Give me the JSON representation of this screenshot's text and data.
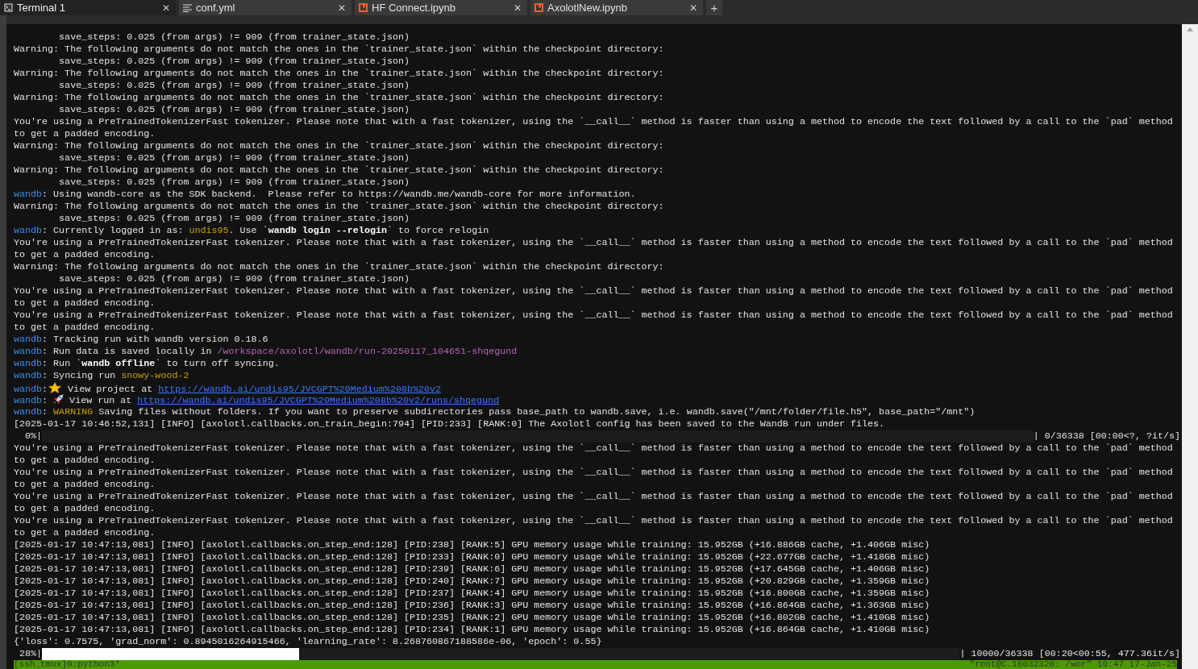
{
  "tabs": [
    {
      "label": "Terminal 1",
      "kind": "terminal",
      "selected": true
    },
    {
      "label": "conf.yml",
      "kind": "text",
      "selected": false
    },
    {
      "label": "HF Connect.ipynb",
      "kind": "notebook",
      "selected": false
    },
    {
      "label": "AxolotlNew.ipynb",
      "kind": "notebook",
      "selected": false
    }
  ],
  "new_tab": "+",
  "close_glyph": "✕",
  "lines": [
    "        save_steps: 0.025 (from args) != 909 (from trainer_state.json)",
    "Warning: The following arguments do not match the ones in the `trainer_state.json` within the checkpoint directory:",
    "        save_steps: 0.025 (from args) != 909 (from trainer_state.json)",
    "Warning: The following arguments do not match the ones in the `trainer_state.json` within the checkpoint directory:",
    "        save_steps: 0.025 (from args) != 909 (from trainer_state.json)",
    "Warning: The following arguments do not match the ones in the `trainer_state.json` within the checkpoint directory:",
    "        save_steps: 0.025 (from args) != 909 (from trainer_state.json)",
    "You're using a PreTrainedTokenizerFast tokenizer. Please note that with a fast tokenizer, using the `__call__` method is faster than using a method to encode the text followed by a call to the `pad` method",
    "to get a padded encoding.",
    "Warning: The following arguments do not match the ones in the `trainer_state.json` within the checkpoint directory:",
    "        save_steps: 0.025 (from args) != 909 (from trainer_state.json)",
    "Warning: The following arguments do not match the ones in the `trainer_state.json` within the checkpoint directory:",
    "        save_steps: 0.025 (from args) != 909 (from trainer_state.json)",
    {
      "segments": [
        {
          "kind": "prefix",
          "t": "wandb"
        },
        {
          "kind": "plain",
          "t": ": Using wandb-core as the SDK backend.  Please refer to https://wandb.me/wandb-core for more information."
        }
      ]
    },
    "Warning: The following arguments do not match the ones in the `trainer_state.json` within the checkpoint directory:",
    "        save_steps: 0.025 (from args) != 909 (from trainer_state.json)",
    {
      "segments": [
        {
          "kind": "prefix",
          "t": "wandb"
        },
        {
          "kind": "plain",
          "t": ": Currently logged in as: "
        },
        {
          "kind": "yellow",
          "t": "undis95"
        },
        {
          "kind": "plain",
          "t": ". Use `"
        },
        {
          "kind": "bold",
          "t": "wandb login --relogin"
        },
        {
          "kind": "plain",
          "t": "` to force relogin"
        }
      ]
    },
    "You're using a PreTrainedTokenizerFast tokenizer. Please note that with a fast tokenizer, using the `__call__` method is faster than using a method to encode the text followed by a call to the `pad` method",
    "to get a padded encoding.",
    "Warning: The following arguments do not match the ones in the `trainer_state.json` within the checkpoint directory:",
    "        save_steps: 0.025 (from args) != 909 (from trainer_state.json)",
    "You're using a PreTrainedTokenizerFast tokenizer. Please note that with a fast tokenizer, using the `__call__` method is faster than using a method to encode the text followed by a call to the `pad` method",
    "to get a padded encoding.",
    "You're using a PreTrainedTokenizerFast tokenizer. Please note that with a fast tokenizer, using the `__call__` method is faster than using a method to encode the text followed by a call to the `pad` method",
    "to get a padded encoding.",
    {
      "segments": [
        {
          "kind": "prefix",
          "t": "wandb"
        },
        {
          "kind": "plain",
          "t": ": Tracking run with wandb version 0.18.6"
        }
      ]
    },
    {
      "segments": [
        {
          "kind": "prefix",
          "t": "wandb"
        },
        {
          "kind": "plain",
          "t": ": Run data is saved locally in "
        },
        {
          "kind": "path",
          "t": "/workspace/axolotl/wandb/run-20250117_104651-shqegund"
        }
      ]
    },
    {
      "segments": [
        {
          "kind": "prefix",
          "t": "wandb"
        },
        {
          "kind": "plain",
          "t": ": Run `"
        },
        {
          "kind": "bold",
          "t": "wandb offline"
        },
        {
          "kind": "plain",
          "t": "` to turn off syncing."
        }
      ]
    },
    {
      "segments": [
        {
          "kind": "prefix",
          "t": "wandb"
        },
        {
          "kind": "plain",
          "t": ": Syncing run "
        },
        {
          "kind": "yellow",
          "t": "snowy-wood-2"
        }
      ]
    },
    {
      "segments": [
        {
          "kind": "prefix",
          "t": "wandb"
        },
        {
          "kind": "plain",
          "t": ":"
        },
        {
          "kind": "star"
        },
        {
          "kind": "plain",
          "t": " View project at "
        },
        {
          "kind": "link",
          "t": "https://wandb.ai/undis95/JVCGPT%20Medium%208b%20v2"
        }
      ]
    },
    {
      "segments": [
        {
          "kind": "prefix",
          "t": "wandb"
        },
        {
          "kind": "plain",
          "t": ": "
        },
        {
          "kind": "rocket"
        },
        {
          "kind": "plain",
          "t": " View run at "
        },
        {
          "kind": "link",
          "t": "https://wandb.ai/undis95/JVCGPT%20Medium%208b%20v2/runs/shqegund"
        }
      ]
    },
    {
      "segments": [
        {
          "kind": "prefix",
          "t": "wandb"
        },
        {
          "kind": "plain",
          "t": ": "
        },
        {
          "kind": "yellow",
          "t": "WARNING"
        },
        {
          "kind": "plain",
          "t": " Saving files without folders. If you want to preserve subdirectories pass base_path to wandb.save, i.e. wandb.save(\"/mnt/folder/file.h5\", base_path=\"/mnt\")"
        }
      ]
    },
    "[2025-01-17 10:46:52,131] [INFO] [axolotl.callbacks.on_train_begin:794] [PID:233] [RANK:0] The Axolotl config has been saved to the WandB run under files.",
    {
      "kind": "progress",
      "left": "  0%|",
      "level": 0,
      "right": "| 0/36338 [00:00<?, ?it/s]"
    },
    "You're using a PreTrainedTokenizerFast tokenizer. Please note that with a fast tokenizer, using the `__call__` method is faster than using a method to encode the text followed by a call to the `pad` method",
    "to get a padded encoding.",
    "You're using a PreTrainedTokenizerFast tokenizer. Please note that with a fast tokenizer, using the `__call__` method is faster than using a method to encode the text followed by a call to the `pad` method",
    "to get a padded encoding.",
    "You're using a PreTrainedTokenizerFast tokenizer. Please note that with a fast tokenizer, using the `__call__` method is faster than using a method to encode the text followed by a call to the `pad` method",
    "to get a padded encoding.",
    "You're using a PreTrainedTokenizerFast tokenizer. Please note that with a fast tokenizer, using the `__call__` method is faster than using a method to encode the text followed by a call to the `pad` method",
    "to get a padded encoding.",
    "[2025-01-17 10:47:13,081] [INFO] [axolotl.callbacks.on_step_end:128] [PID:238] [RANK:5] GPU memory usage while training: 15.952GB (+16.886GB cache, +1.406GB misc)",
    "[2025-01-17 10:47:13,081] [INFO] [axolotl.callbacks.on_step_end:128] [PID:233] [RANK:0] GPU memory usage while training: 15.952GB (+22.677GB cache, +1.418GB misc)",
    "[2025-01-17 10:47:13,081] [INFO] [axolotl.callbacks.on_step_end:128] [PID:239] [RANK:6] GPU memory usage while training: 15.952GB (+17.645GB cache, +1.406GB misc)",
    "[2025-01-17 10:47:13,081] [INFO] [axolotl.callbacks.on_step_end:128] [PID:240] [RANK:7] GPU memory usage while training: 15.952GB (+20.829GB cache, +1.359GB misc)",
    "[2025-01-17 10:47:13,081] [INFO] [axolotl.callbacks.on_step_end:128] [PID:237] [RANK:4] GPU memory usage while training: 15.952GB (+16.800GB cache, +1.359GB misc)",
    "[2025-01-17 10:47:13,081] [INFO] [axolotl.callbacks.on_step_end:128] [PID:236] [RANK:3] GPU memory usage while training: 15.952GB (+16.864GB cache, +1.363GB misc)",
    "[2025-01-17 10:47:13,081] [INFO] [axolotl.callbacks.on_step_end:128] [PID:235] [RANK:2] GPU memory usage while training: 15.952GB (+16.802GB cache, +1.410GB misc)",
    "[2025-01-17 10:47:13,081] [INFO] [axolotl.callbacks.on_step_end:128] [PID:234] [RANK:1] GPU memory usage while training: 15.952GB (+16.864GB cache, +1.410GB misc)",
    "{'loss': 0.7575, 'grad_norm': 0.8945016264915466, 'learning_rate': 8.268760867188586e-06, 'epoch': 0.55}",
    {
      "kind": "progress",
      "left": " 28%|",
      "level": 0.28,
      "right": "| 10000/36338 [00:20<00:55, 477.36it/s]"
    }
  ],
  "status_bar": {
    "left": "[ssh_tmux]0:python3*",
    "right": "\"root@C.16032326: /wor\" 10:47 17-Jan-25"
  }
}
